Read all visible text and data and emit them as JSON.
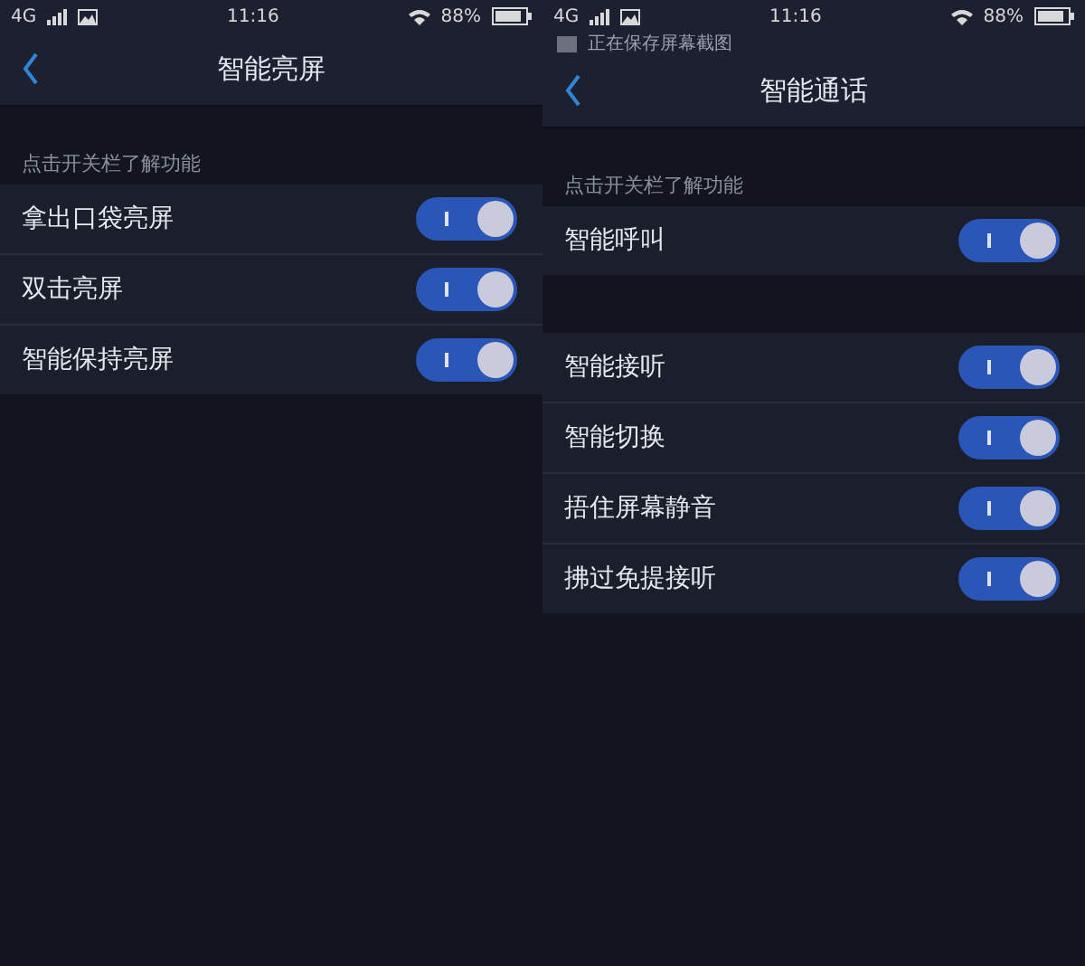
{
  "screens": [
    {
      "status_bar": {
        "network": "4G",
        "time": "11:16",
        "battery": "88%"
      },
      "title": "智能亮屏",
      "section_label": "点击开关栏了解功能",
      "groups": [
        [
          {
            "label": "拿出口袋亮屏",
            "on": true
          },
          {
            "label": "双击亮屏",
            "on": true
          },
          {
            "label": "智能保持亮屏",
            "on": true
          }
        ]
      ]
    },
    {
      "status_bar": {
        "network": "4G",
        "time": "11:16",
        "battery": "88%"
      },
      "notification": "正在保存屏幕截图",
      "title": "智能通话",
      "section_label": "点击开关栏了解功能",
      "groups": [
        [
          {
            "label": "智能呼叫",
            "on": true
          }
        ],
        [
          {
            "label": "智能接听",
            "on": true
          },
          {
            "label": "智能切换",
            "on": true
          },
          {
            "label": "捂住屏幕静音",
            "on": true
          },
          {
            "label": "拂过免提接听",
            "on": true
          }
        ]
      ]
    }
  ]
}
